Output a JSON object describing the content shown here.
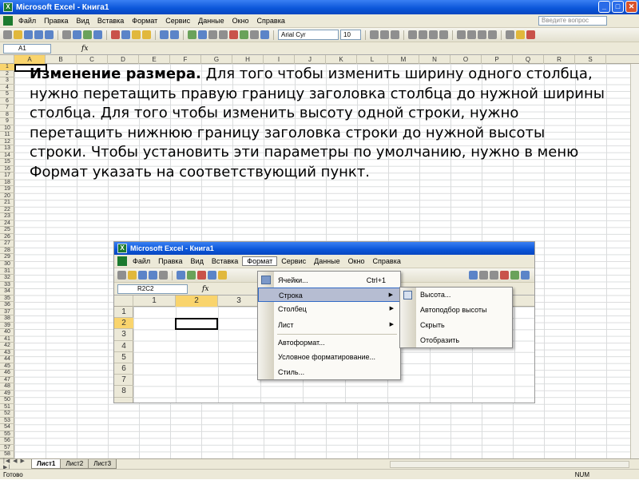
{
  "window": {
    "title": "Microsoft Excel - Книга1"
  },
  "menu": [
    "Файл",
    "Правка",
    "Вид",
    "Вставка",
    "Формат",
    "Сервис",
    "Данные",
    "Окно",
    "Справка"
  ],
  "help_placeholder": "Введите вопрос",
  "font": {
    "name": "Arial Cyr",
    "size": "10"
  },
  "namebox": "A1",
  "fx": "fx",
  "columns": [
    "A",
    "B",
    "C",
    "D",
    "E",
    "F",
    "G",
    "H",
    "I",
    "J",
    "K",
    "L",
    "M",
    "N",
    "O",
    "P",
    "Q",
    "R",
    "S"
  ],
  "rows": [
    "1",
    "2",
    "3",
    "4",
    "5",
    "6",
    "7",
    "8",
    "9",
    "10",
    "11",
    "12",
    "13",
    "14",
    "15",
    "16",
    "17",
    "18",
    "19",
    "20",
    "21",
    "22",
    "23",
    "24",
    "25",
    "26",
    "27",
    "28",
    "29",
    "30",
    "31",
    "32",
    "33",
    "34",
    "35",
    "36",
    "37",
    "38",
    "39",
    "40",
    "41",
    "42",
    "43",
    "44",
    "45",
    "46",
    "47",
    "48",
    "49",
    "50",
    "51",
    "52",
    "53",
    "54",
    "55",
    "56",
    "57",
    "58"
  ],
  "slide": {
    "heading": "Изменение размера.",
    "body": " Для того чтобы изменить ширину одного столбца, нужно перетащить правую границу заголовка столбца до нужной ширины столбца. Для того чтобы изменить высоту одной строки, нужно перетащить нижнюю границу заголовка строки до нужной высоты строки. Чтобы установить эти параметры по умолчанию, нужно в меню Формат указать на соответствующий пункт."
  },
  "inner": {
    "title": "Microsoft Excel - Книга1",
    "namebox": "R2C2",
    "columns": [
      "1",
      "2",
      "3"
    ],
    "rows": [
      "1",
      "2",
      "3",
      "4",
      "5",
      "6",
      "7",
      "8"
    ],
    "format_menu": {
      "items": [
        {
          "label": "Ячейки...",
          "shortcut": "Ctrl+1"
        },
        {
          "label": "Строка",
          "submenu": true
        },
        {
          "label": "Столбец",
          "submenu": true
        },
        {
          "label": "Лист",
          "submenu": true
        },
        {
          "label": "Автоформат..."
        },
        {
          "label": "Условное форматирование..."
        },
        {
          "label": "Стиль..."
        }
      ]
    },
    "row_submenu": [
      "Высота...",
      "Автоподбор высоты",
      "Скрыть",
      "Отобразить"
    ]
  },
  "sheets": [
    "Лист1",
    "Лист2",
    "Лист3"
  ],
  "status": {
    "left": "Готово",
    "num": "NUM"
  }
}
